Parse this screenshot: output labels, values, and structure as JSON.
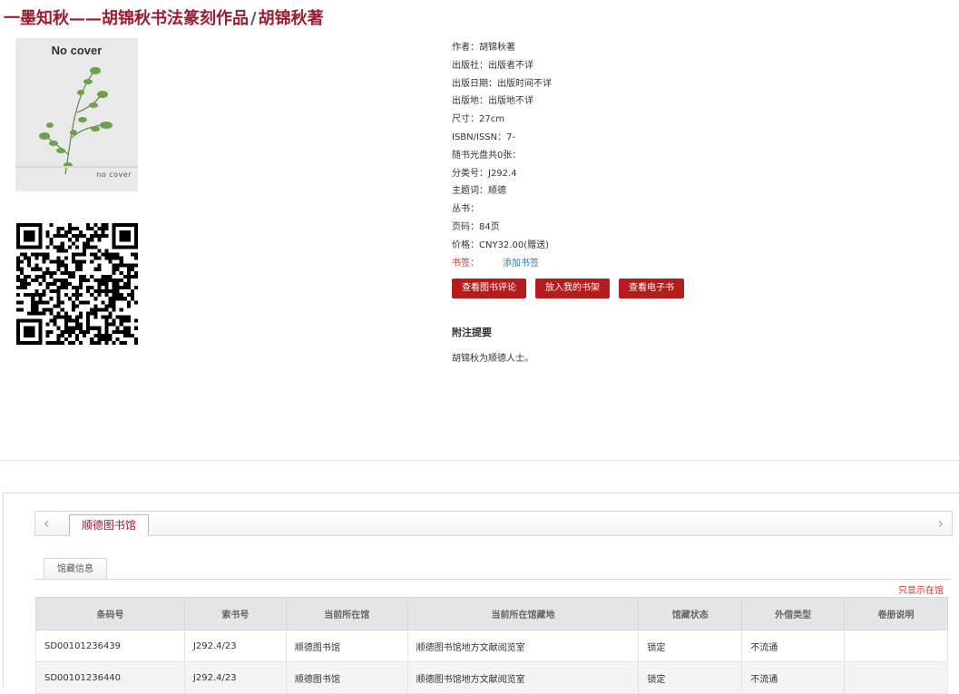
{
  "title": {
    "main": "一墨知秋——胡锦秋书法篆刻作品",
    "sep": "/",
    "author": "胡锦秋著"
  },
  "cover": {
    "text": "No cover",
    "foot": "no cover"
  },
  "meta": {
    "author": "作者：胡锦秋著",
    "publisher": "出版社：出版者不详",
    "pub_date": "出版日期：出版时间不详",
    "pub_place": "出版地：出版地不详",
    "size": "尺寸：27cm",
    "isbn": "ISBN/ISSN：7-",
    "disc": "随书光盘共0张：",
    "class_no": "分类号：J292.4",
    "subject": "主题词：顺德",
    "series": "丛书：",
    "pages": "页码：84页",
    "price": "价格：CNY32.00(赠送)",
    "bookmark_label": "书签：",
    "bookmark_link": "添加书签"
  },
  "buttons": {
    "review": "查看图书评论",
    "shelf": "放入我的书架",
    "ebook": "查看电子书"
  },
  "notes": {
    "heading": "附注提要",
    "text": "胡锦秋为顺德人士。"
  },
  "library_tab": "顺德图书馆",
  "sub_tab": "馆藏信息",
  "only_in_lib": "只显示在馆",
  "holdings": {
    "headers": [
      "条码号",
      "索书号",
      "当前所在馆",
      "当前所在馆藏地",
      "馆藏状态",
      "外借类型",
      "卷册说明"
    ],
    "rows": [
      [
        "SD00101236439",
        "J292.4/23",
        "顺德图书馆",
        "顺德图书馆地方文献阅览室",
        "锁定",
        "不流通",
        ""
      ],
      [
        "SD00101236440",
        "J292.4/23",
        "顺德图书馆",
        "顺德图书馆地方文献阅览室",
        "锁定",
        "不流通",
        ""
      ]
    ]
  },
  "colors": {
    "accent": "#9b1b30",
    "button": "#b51d1d",
    "link": "#2a7ab5"
  }
}
